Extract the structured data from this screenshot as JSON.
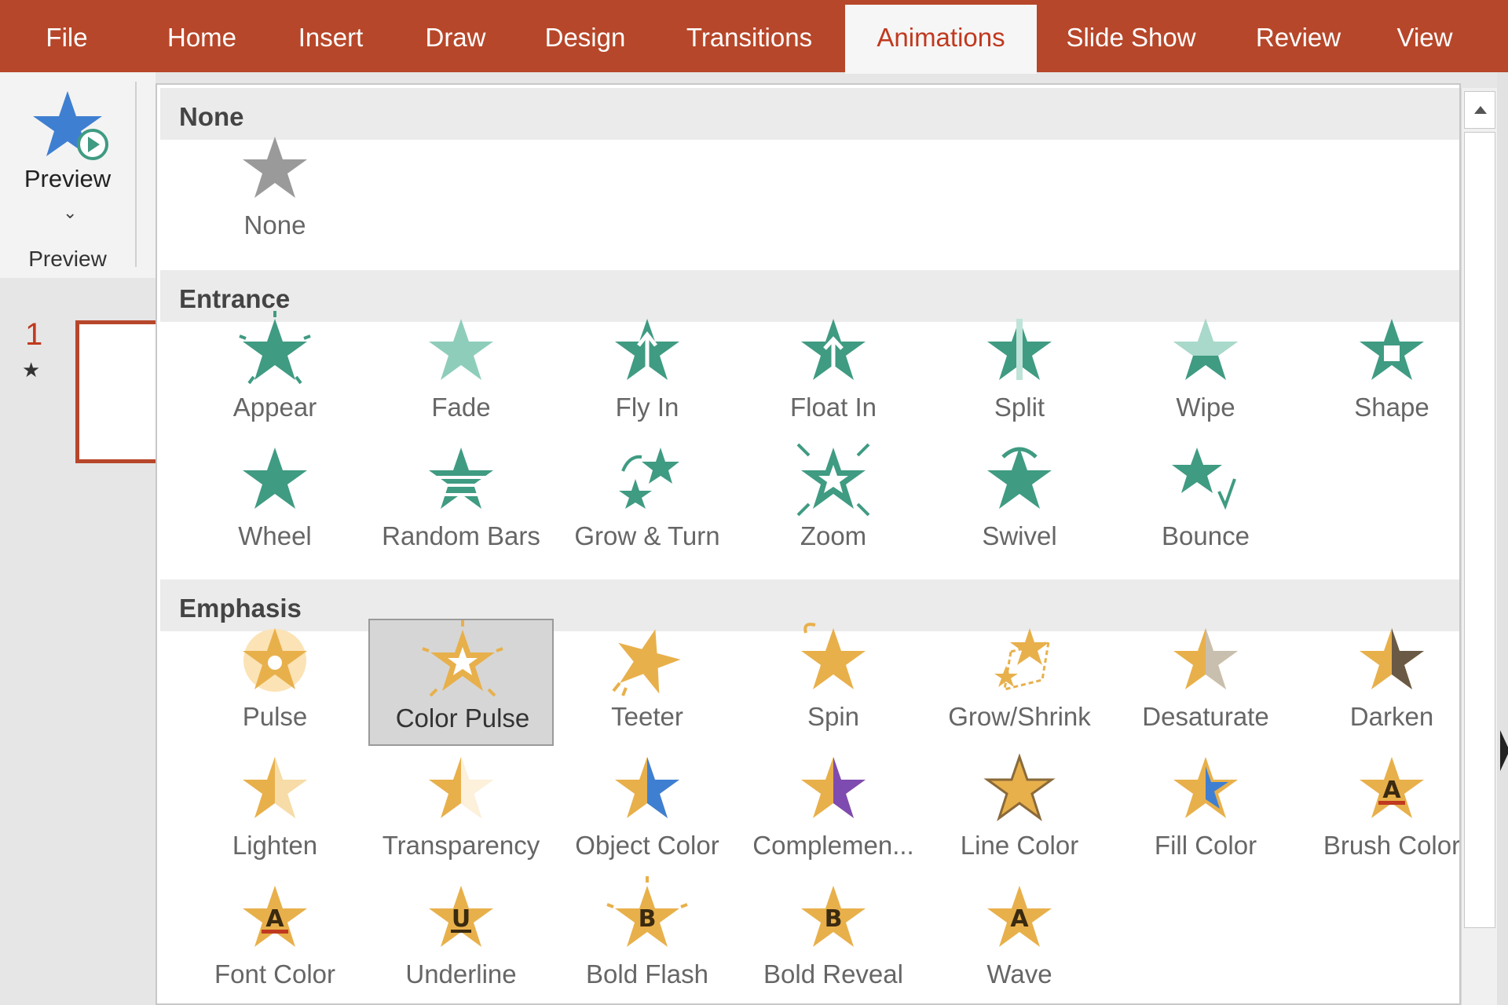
{
  "tabs": [
    {
      "label": "File",
      "active": false
    },
    {
      "label": "Home",
      "active": false
    },
    {
      "label": "Insert",
      "active": false
    },
    {
      "label": "Draw",
      "active": false
    },
    {
      "label": "Design",
      "active": false
    },
    {
      "label": "Transitions",
      "active": false
    },
    {
      "label": "Animations",
      "active": true
    },
    {
      "label": "Slide Show",
      "active": false
    },
    {
      "label": "Review",
      "active": false
    },
    {
      "label": "View",
      "active": false
    }
  ],
  "preview": {
    "button_label": "Preview",
    "group_label": "Preview"
  },
  "slide_pane": {
    "slide_number": "1"
  },
  "colors": {
    "accent": "#b7472a",
    "entrance": "#3f9b82",
    "emphasis": "#e8b04b",
    "none": "#9a9a9a"
  },
  "gallery": {
    "sections": [
      {
        "header": "None",
        "items": [
          {
            "label": "None",
            "icon": "star-gray-icon"
          }
        ]
      },
      {
        "header": "Entrance",
        "items": [
          {
            "label": "Appear",
            "icon": "appear-icon"
          },
          {
            "label": "Fade",
            "icon": "fade-icon"
          },
          {
            "label": "Fly In",
            "icon": "fly-in-icon"
          },
          {
            "label": "Float In",
            "icon": "float-in-icon"
          },
          {
            "label": "Split",
            "icon": "split-icon"
          },
          {
            "label": "Wipe",
            "icon": "wipe-icon"
          },
          {
            "label": "Shape",
            "icon": "shape-icon"
          },
          {
            "label": "Wheel",
            "icon": "wheel-icon"
          },
          {
            "label": "Random Bars",
            "icon": "random-bars-icon"
          },
          {
            "label": "Grow & Turn",
            "icon": "grow-turn-icon"
          },
          {
            "label": "Zoom",
            "icon": "zoom-icon"
          },
          {
            "label": "Swivel",
            "icon": "swivel-icon"
          },
          {
            "label": "Bounce",
            "icon": "bounce-icon"
          }
        ]
      },
      {
        "header": "Emphasis",
        "items": [
          {
            "label": "Pulse",
            "icon": "pulse-icon"
          },
          {
            "label": "Color Pulse",
            "icon": "color-pulse-icon",
            "selected": true
          },
          {
            "label": "Teeter",
            "icon": "teeter-icon"
          },
          {
            "label": "Spin",
            "icon": "spin-icon"
          },
          {
            "label": "Grow/Shrink",
            "icon": "grow-shrink-icon"
          },
          {
            "label": "Desaturate",
            "icon": "desaturate-icon"
          },
          {
            "label": "Darken",
            "icon": "darken-icon"
          },
          {
            "label": "Lighten",
            "icon": "lighten-icon"
          },
          {
            "label": "Transparency",
            "icon": "transparency-icon"
          },
          {
            "label": "Object Color",
            "icon": "object-color-icon"
          },
          {
            "label": "Complemen...",
            "icon": "complementary-color-icon"
          },
          {
            "label": "Line Color",
            "icon": "line-color-icon"
          },
          {
            "label": "Fill Color",
            "icon": "fill-color-icon"
          },
          {
            "label": "Brush Color",
            "icon": "brush-color-icon",
            "glyph": "A"
          },
          {
            "label": "Font Color",
            "icon": "font-color-icon",
            "glyph": "A"
          },
          {
            "label": "Underline",
            "icon": "underline-icon",
            "glyph": "U"
          },
          {
            "label": "Bold Flash",
            "icon": "bold-flash-icon",
            "glyph": "B"
          },
          {
            "label": "Bold Reveal",
            "icon": "bold-reveal-icon",
            "glyph": "B"
          },
          {
            "label": "Wave",
            "icon": "wave-icon",
            "glyph": "A"
          }
        ]
      }
    ]
  }
}
